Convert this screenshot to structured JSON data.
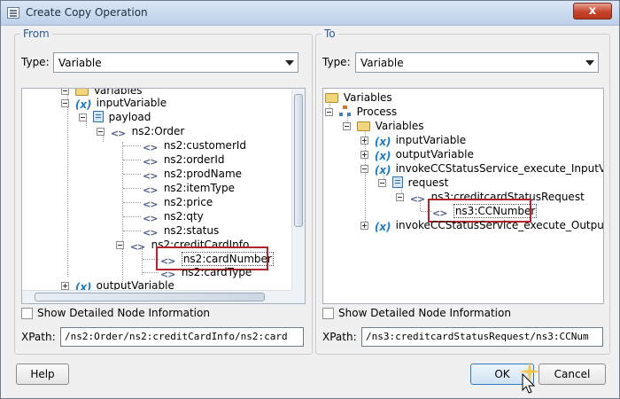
{
  "window": {
    "title": "Create Copy Operation",
    "close_glyph": "x"
  },
  "from": {
    "legend": "From",
    "type_label": "Type:",
    "type_value": "Variable",
    "tree": {
      "partial_top": "Variables",
      "input_variable": "inputVariable",
      "payload": "payload",
      "order": "ns2:Order",
      "fields": [
        "ns2:customerId",
        "ns2:orderId",
        "ns2:prodName",
        "ns2:itemType",
        "ns2:price",
        "ns2:qty",
        "ns2:status"
      ],
      "credit_card_info": "ns2:creditCardInfo",
      "card_number": "ns2:cardNumber",
      "card_type": "ns2:cardType",
      "output_variable": "outputVariable"
    },
    "show_detailed": "Show Detailed Node Information",
    "xpath_label": "XPath:",
    "xpath_value": "/ns2:Order/ns2:creditCardInfo/ns2:card"
  },
  "to": {
    "legend": "To",
    "type_label": "Type:",
    "type_value": "Variable",
    "tree": {
      "variables": "Variables",
      "process": "Process",
      "variables_folder": "Variables",
      "input_variable": "inputVariable",
      "output_variable": "outputVariable",
      "invoke_input": "invokeCCStatusService_execute_InputVa",
      "request": "request",
      "credit_status_request": "ns3:creditcardStatusRequest",
      "cc_number": "ns3:CCNumber",
      "invoke_output": "invokeCCStatusService_execute_OutputV"
    },
    "show_detailed": "Show Detailed Node Information",
    "xpath_label": "XPath:",
    "xpath_value": "/ns3:creditcardStatusRequest/ns3:CCNum"
  },
  "buttons": {
    "help": "Help",
    "ok": "OK",
    "cancel": "Cancel"
  },
  "colors": {
    "highlight_box": "#b3252a",
    "legend_text": "#2a5c9a"
  }
}
